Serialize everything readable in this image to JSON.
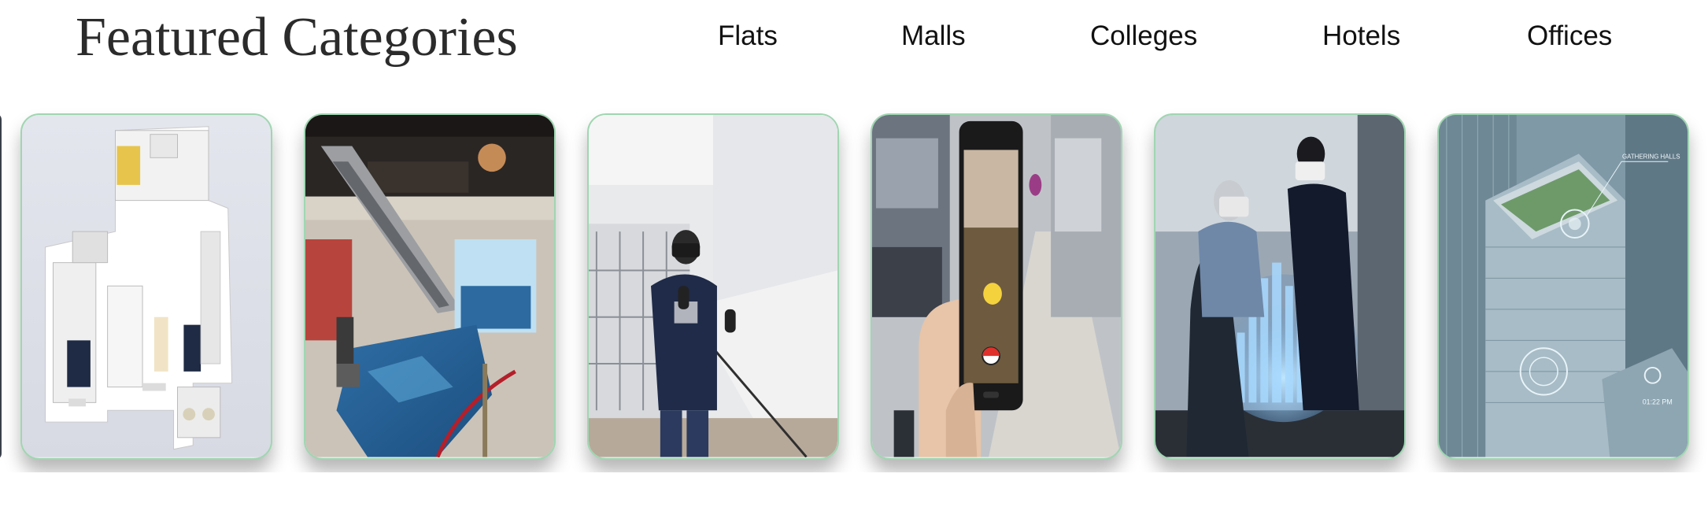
{
  "header": {
    "title": "Featured Categories",
    "tabs": [
      {
        "label": "Flats"
      },
      {
        "label": "Malls"
      },
      {
        "label": "Colleges"
      },
      {
        "label": "Hotels"
      },
      {
        "label": "Offices"
      }
    ]
  },
  "carousel": {
    "cards": [
      {
        "icon": "floor-plan-image",
        "subject": "apartment 3D floor plan"
      },
      {
        "icon": "mall-interior-image",
        "subject": "shopping mall escalator with interactive floor"
      },
      {
        "icon": "vr-user-image",
        "subject": "person using VR headset"
      },
      {
        "icon": "ar-phone-image",
        "subject": "phone showing augmented reality game on street"
      },
      {
        "icon": "hologram-city-image",
        "subject": "people with VR headsets viewing holographic city"
      },
      {
        "icon": "smart-building-image",
        "subject": "aerial view of city building with overlays",
        "overlay_texts": [
          "GATHERING HALLS",
          "01:22 PM"
        ]
      }
    ]
  },
  "colors": {
    "card_border": "#9fd6b1",
    "title_text": "#2b2b2b",
    "tab_text": "#111111"
  }
}
